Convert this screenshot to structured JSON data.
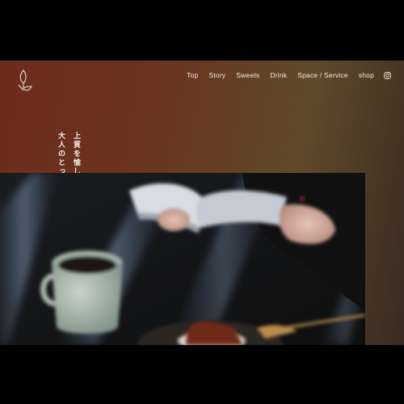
{
  "nav": {
    "items": [
      {
        "label": "Top"
      },
      {
        "label": "Story"
      },
      {
        "label": "Sweets"
      },
      {
        "label": "Drink"
      },
      {
        "label": "Space / Service"
      },
      {
        "label": "shop"
      }
    ],
    "instagram_icon": "instagram-icon"
  },
  "logo": {
    "icon": "sprout-logo-icon"
  },
  "tagline": {
    "line1": "上質を愉しむ、",
    "line2": "大人のとっておき。"
  },
  "hero": {
    "image": "coffee-and-reading-photo"
  },
  "colors": {
    "background_start": "#6e2c1c",
    "background_end": "#3a2a22",
    "text": "#f3ece4",
    "frame": "#000000"
  }
}
